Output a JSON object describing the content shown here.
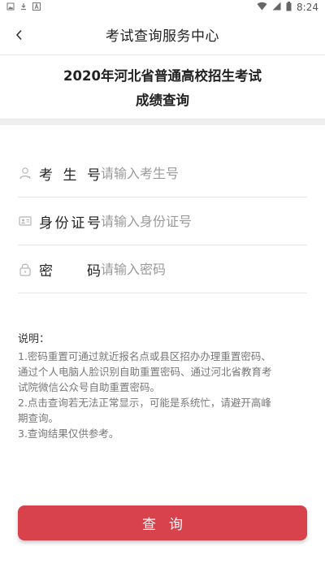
{
  "status_bar": {
    "time": "8:24",
    "icons": [
      "image-notification-icon",
      "download-notification-icon",
      "a-notification-icon",
      "wifi-icon",
      "signal-icon",
      "battery-icon"
    ]
  },
  "nav": {
    "title": "考试查询服务中心",
    "back_icon": "chevron-left-icon"
  },
  "exam": {
    "title_line1": "2020年河北省普通高校招生考试",
    "title_line2": "成绩查询"
  },
  "form": {
    "exam_number": {
      "label": "考生号",
      "placeholder": "请输入考生号",
      "icon": "person-icon"
    },
    "id_number": {
      "label": "身份证号",
      "placeholder": "请输入身份证号",
      "icon": "id-card-icon"
    },
    "password": {
      "label": "密码",
      "placeholder": "请输入密码",
      "icon": "lock-icon"
    }
  },
  "notes": {
    "title": "说明：",
    "lines": [
      "1.密码重置可通过就近报名点或县区招办办理重置密码、",
      "通过个人电脑人脸识别自助重置密码、通过河北省教育考",
      "试院微信公众号自助重置密码。",
      "2.点击查询若无法正常显示，可能是系统忙，请避开高峰",
      "期查询。",
      "3.查询结果仅供参考。"
    ]
  },
  "actions": {
    "query_label": "查询"
  },
  "colors": {
    "accent": "#d8424c",
    "divider": "#e6e6e6",
    "placeholder": "#9a9a9a"
  }
}
